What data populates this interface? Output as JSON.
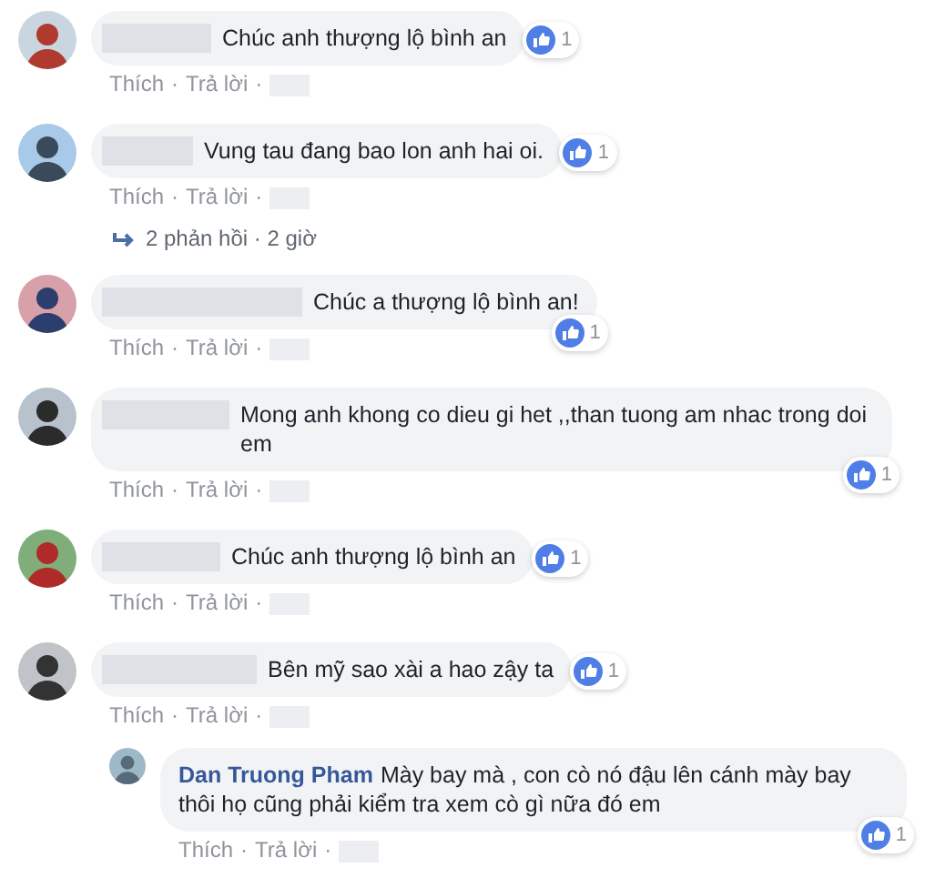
{
  "separator": "·",
  "comments": [
    {
      "text": "Chúc anh thượng lộ bình an",
      "likes": "1",
      "actions": [
        "Thích",
        "Trả lời"
      ]
    },
    {
      "text": "Vung tau đang bao lon anh hai oi.",
      "likes": "1",
      "actions": [
        "Thích",
        "Trả lời"
      ],
      "replies_link": "2 phản hồi · 2 giờ"
    },
    {
      "text": "Chúc a thượng lộ bình an!",
      "likes": "1",
      "actions": [
        "Thích",
        "Trả lời"
      ]
    },
    {
      "text": "Mong anh khong co dieu gi het ,,than tuong am nhac trong doi em",
      "likes": "1",
      "actions": [
        "Thích",
        "Trả lời"
      ]
    },
    {
      "text": "Chúc anh thượng lộ bình an",
      "likes": "1",
      "actions": [
        "Thích",
        "Trả lời"
      ]
    },
    {
      "text": "Bên mỹ sao xài a hao zậy ta",
      "likes": "1",
      "actions": [
        "Thích",
        "Trả lời"
      ],
      "reply": {
        "author": "Dan Truong Pham",
        "text": "Mày bay mà , con cò nó đậu lên cánh mày bay thôi họ cũng phải kiểm tra xem cò gì nữa đó em",
        "likes": "1",
        "actions": [
          "Thích",
          "Trả lời"
        ]
      }
    }
  ]
}
